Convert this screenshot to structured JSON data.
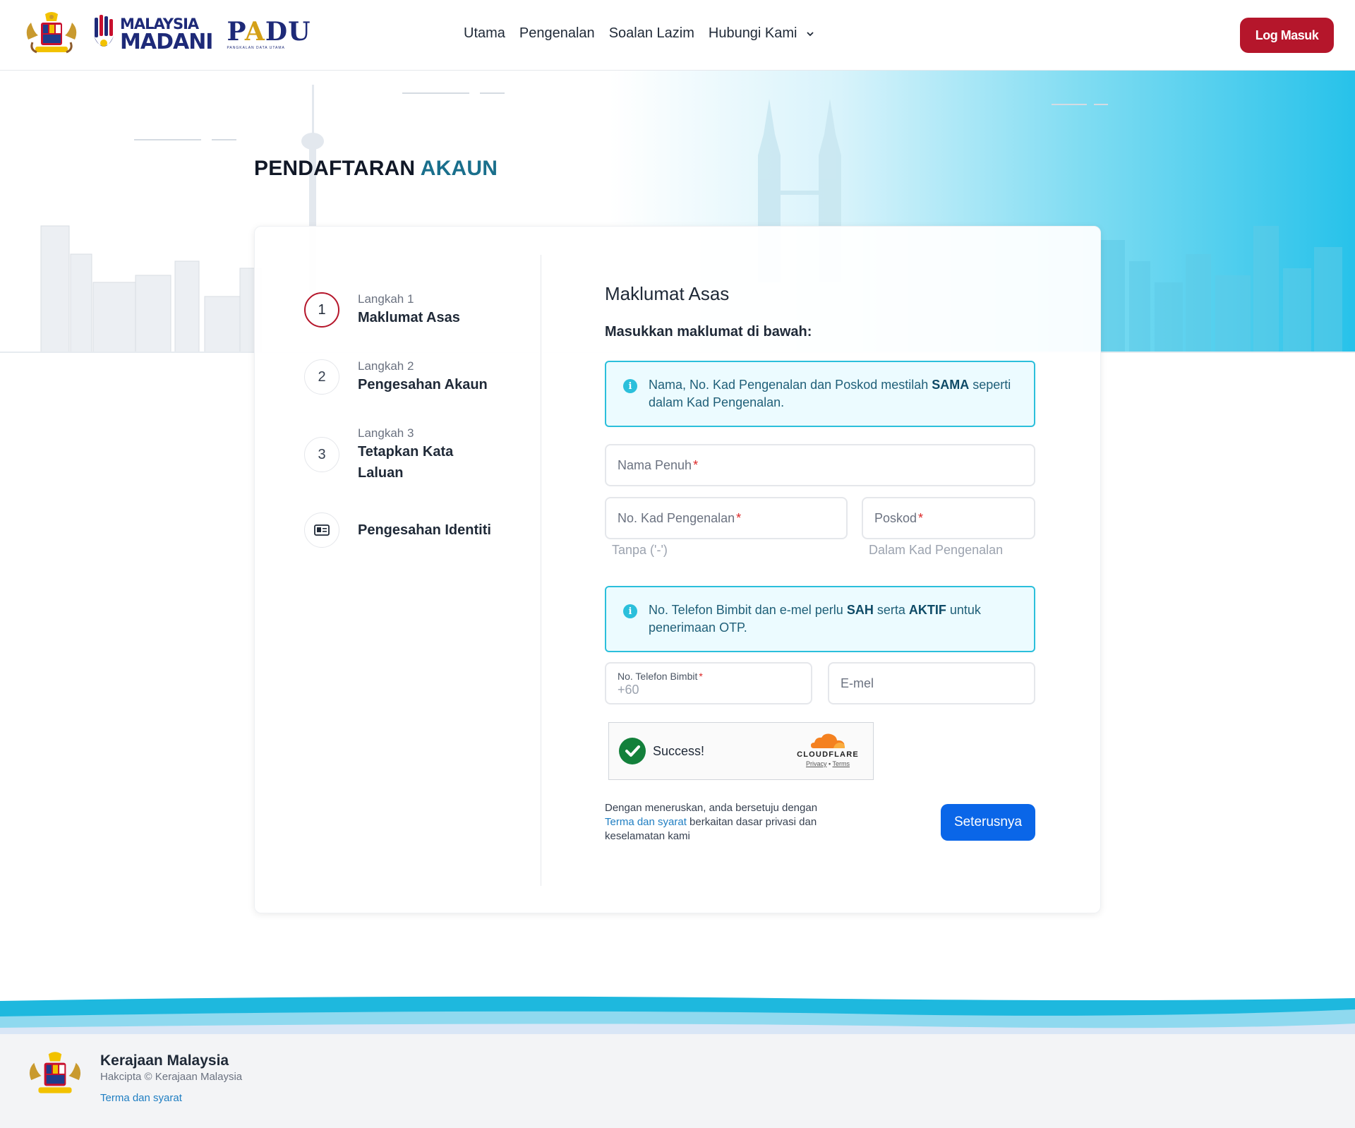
{
  "header": {
    "nav": [
      "Utama",
      "Pengenalan",
      "Soalan Lazim",
      "Hubungi Kami"
    ],
    "login_label": "Log Masuk",
    "madani_line1": "MALAYSIA",
    "madani_line2": "MADANI",
    "padu_p": "P",
    "padu_a": "A",
    "padu_du": "DU",
    "padu_sub": "PANGKALAN DATA UTAMA"
  },
  "page": {
    "title_part1": "PENDAFTARAN",
    "title_part2": "AKAUN"
  },
  "steps": [
    {
      "number": "1",
      "small": "Langkah 1",
      "label": "Maklumat Asas",
      "active": true
    },
    {
      "number": "2",
      "small": "Langkah 2",
      "label": "Pengesahan Akaun",
      "active": false
    },
    {
      "number": "3",
      "small": "Langkah 3",
      "label_line1": "Tetapkan Kata",
      "label_line2": "Laluan",
      "active": false
    },
    {
      "icon": "id-card-icon",
      "label": "Pengesahan Identiti",
      "active": false
    }
  ],
  "form": {
    "title": "Maklumat Asas",
    "subtitle": "Masukkan maklumat di bawah:",
    "alert1": {
      "text1": "Nama, No. Kad Pengenalan dan Poskod mestilah ",
      "bold1": "SAMA",
      "text2": " seperti dalam Kad Pengenalan."
    },
    "full_name_label": "Nama Penuh",
    "ic_label": "No. Kad Pengenalan",
    "ic_hint": "Tanpa ('-')",
    "postcode_label": "Poskod",
    "postcode_hint": "Dalam Kad Pengenalan",
    "alert2": {
      "text1": "No. Telefon Bimbit dan e-mel perlu ",
      "bold1": "SAH",
      "text2": " serta ",
      "bold2": "AKTIF",
      "text3": " untuk penerimaan OTP."
    },
    "phone_label": "No. Telefon Bimbit",
    "phone_value": "+60",
    "email_label": "E-mel",
    "required_mark": "*",
    "captcha": {
      "status": "Success!",
      "brand": "CLOUDFLARE",
      "privacy": "Privacy",
      "separator": "•",
      "terms": "Terms"
    },
    "consent": {
      "text1": "Dengan meneruskan, anda bersetuju dengan ",
      "link": "Terma dan syarat",
      "text2": " berkaitan dasar privasi dan keselamatan kami"
    },
    "next_label": "Seterusnya"
  },
  "footer": {
    "title": "Kerajaan Malaysia",
    "copyright": "Hakcipta © Kerajaan Malaysia",
    "link": "Terma dan syarat"
  },
  "colors": {
    "brand_red": "#b5162b",
    "accent_teal": "#1a6f8c",
    "primary_blue": "#0a66e8",
    "info_cyan": "#2bbfdb"
  }
}
